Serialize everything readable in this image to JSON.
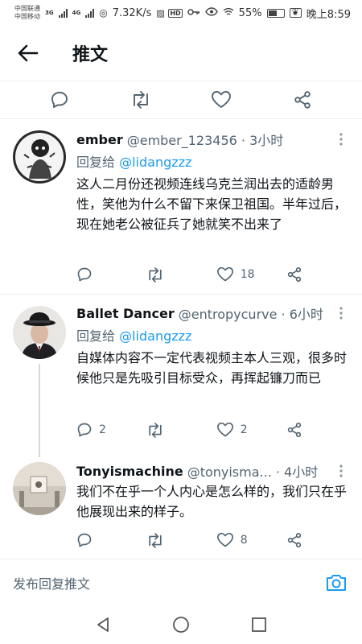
{
  "status_bar": {
    "carrier1": "中国联通",
    "carrier2": "中国移动",
    "net1": "3G",
    "net2": "4G",
    "speed": "7.32K/s",
    "hd": "HD",
    "battery": "55%",
    "time": "晚上8:59"
  },
  "header": {
    "title": "推文"
  },
  "replies": [
    {
      "name": "ember",
      "handle": "@ember_123456 · 3小时",
      "replying_label": "回复给 ",
      "replying_to": "@lidangzzz",
      "text": "这人二月份还视频连线乌克兰润出去的适龄男性，笑他为什么不留下来保卫祖国。半年过后，现在她老公被征兵了她就笑不出来了",
      "reply_count": "",
      "retweet_count": "",
      "like_count": "18"
    },
    {
      "name": "Ballet Dancer",
      "handle": "@entropycurve · 6小时",
      "replying_label": "回复给 ",
      "replying_to": "@lidangzzz",
      "text": "自媒体内容不一定代表视频主本人三观，很多时候他只是先吸引目标受众，再挥起镰刀而已",
      "reply_count": "2",
      "retweet_count": "",
      "like_count": "2"
    },
    {
      "name": "Tonyismachine",
      "handle": "@tonyisma... · 4小时",
      "text": "我们不在乎一个人内心是怎么样的，我们只在乎他展现出来的样子。",
      "reply_count": "",
      "retweet_count": "",
      "like_count": "8"
    }
  ],
  "compose": {
    "placeholder": "发布回复推文"
  },
  "colors": {
    "accent": "#1d9bf0",
    "text": "#0f1419",
    "muted": "#536471",
    "divider": "#eceff1"
  }
}
